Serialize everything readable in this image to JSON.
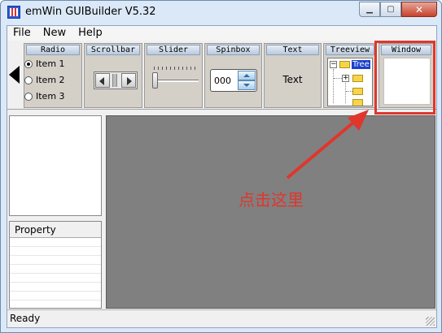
{
  "window": {
    "title": "emWin GUIBuilder V5.32",
    "controls": {
      "minimize": "▁",
      "maximize": "▢",
      "close": "✕"
    }
  },
  "menu": [
    "File",
    "New",
    "Help"
  ],
  "palette": {
    "radio": {
      "title": "Radio",
      "items": [
        "Item 1",
        "Item 2",
        "Item 3"
      ],
      "selected": "Item 1"
    },
    "scrollbar": {
      "title": "Scrollbar"
    },
    "slider": {
      "title": "Slider"
    },
    "spinbox": {
      "title": "Spinbox",
      "value": "000"
    },
    "text": {
      "title": "Text",
      "sample": "Text"
    },
    "treeview": {
      "title": "Treeview",
      "root_label": "Tree"
    },
    "window": {
      "title": "Window"
    }
  },
  "panes": {
    "property_header": "Property"
  },
  "status": {
    "text": "Ready"
  },
  "annotation": {
    "text": "点击这里",
    "color": "#e0362c"
  },
  "colors": {
    "canvas": "#808080",
    "highlight": "#e0362c",
    "tree_selection": "#1a3fcc"
  }
}
